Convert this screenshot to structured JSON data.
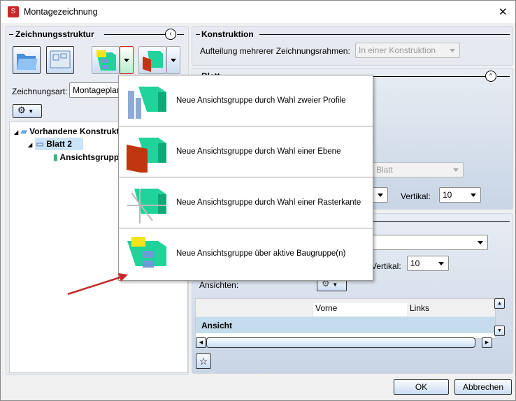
{
  "window": {
    "title": "Montagezeichnung",
    "close": "✕"
  },
  "left": {
    "title": "Zeichnungsstruktur",
    "drawing_type_label": "Zeichnungsart:",
    "drawing_type_value": "Montageplan",
    "tree": [
      {
        "label": "Vorhandene Konstruktion",
        "level": 0
      },
      {
        "label": "Blatt 2",
        "level": 1,
        "selected": true
      },
      {
        "label": "Ansichtsgruppe",
        "level": 2
      }
    ]
  },
  "konstruktion": {
    "title": "Konstruktion",
    "label": "Aufteilung mehrerer Zeichnungsrahmen:",
    "value": "In einer Konstruktion"
  },
  "blatt": {
    "title": "Blatt",
    "combo_value": "Blatt",
    "vertikal_label": "Vertikal:",
    "vertikal_value": "10"
  },
  "group": {
    "combo_value": "n",
    "vertikal_label": "Vertikal:",
    "vertikal_value": "10",
    "views_label": "Ansichten:",
    "table": {
      "columns": [
        "",
        "Vorne",
        "Links"
      ],
      "row_header": "Ansicht"
    }
  },
  "menu": {
    "items": [
      "Neue Ansichtsgruppe durch Wahl zweier Profile",
      "Neue Ansichtsgruppe durch Wahl einer Ebene",
      "Neue Ansichtsgruppe durch Wahl einer Rasterkante",
      "Neue Ansichtsgruppe über aktive Baugruppe(n)"
    ]
  },
  "footer": {
    "ok": "OK",
    "cancel": "Abbrechen"
  },
  "colors": {
    "accent_red": "#d42020",
    "selection": "#cce4f7",
    "box_green": "#1fd39a"
  }
}
